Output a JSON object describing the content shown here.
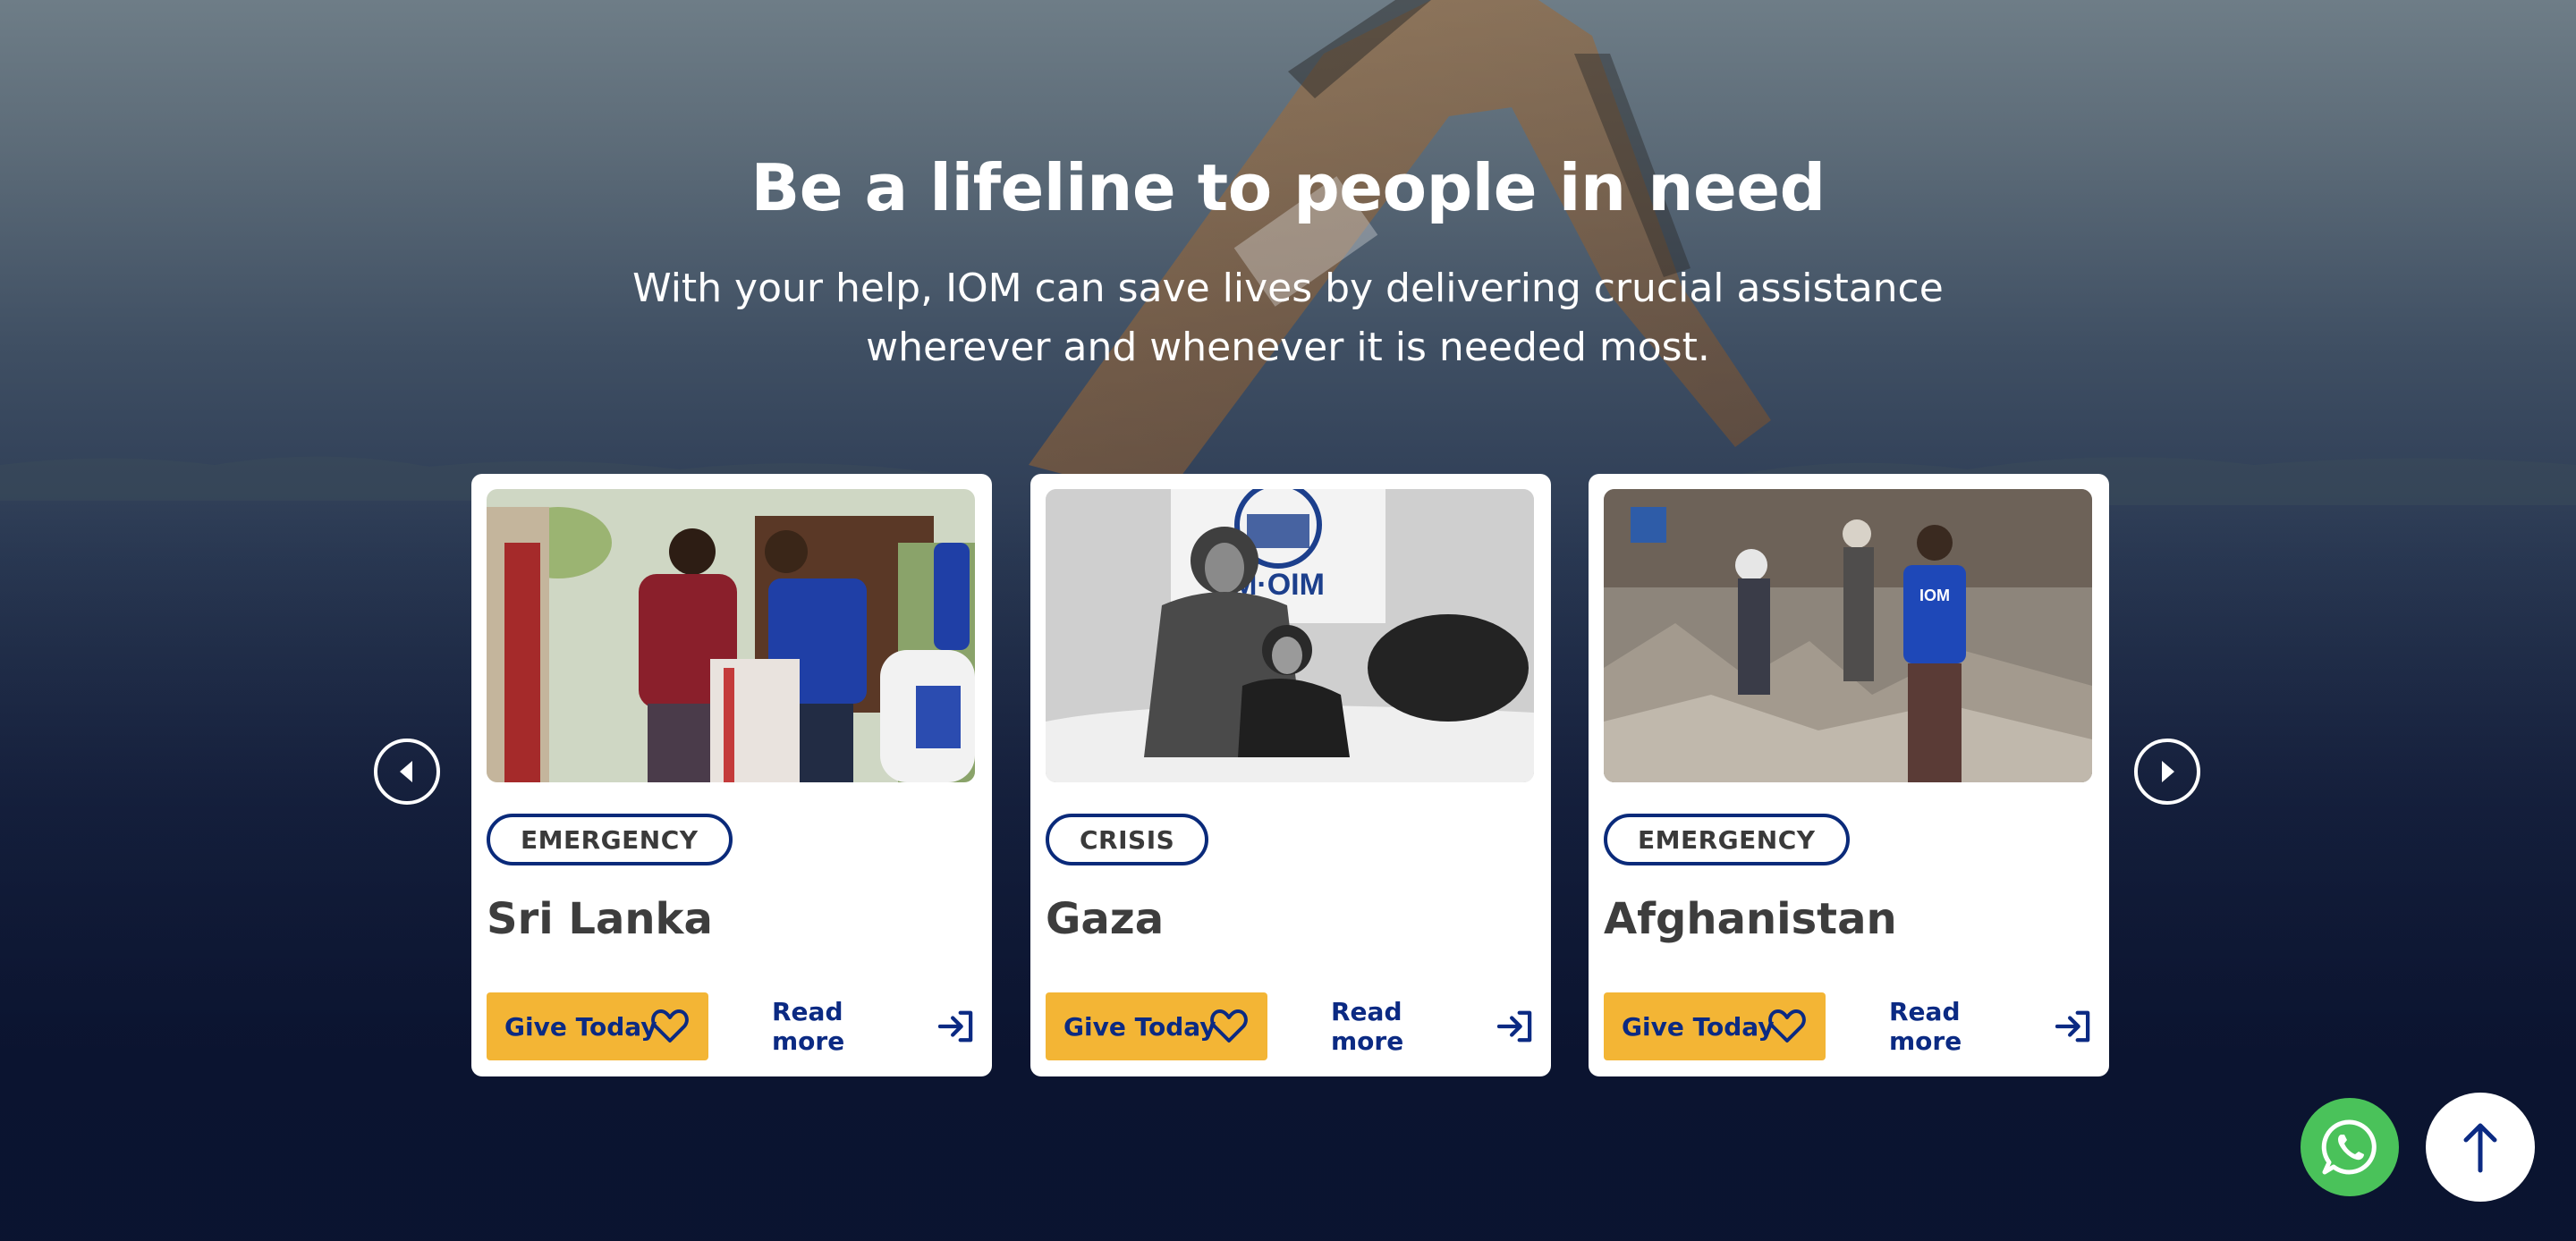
{
  "hero": {
    "title": "Be a lifeline to people in need",
    "subtitle_line1": "With your help, IOM can save lives by delivering crucial assistance",
    "subtitle_line2": "wherever and whenever it is needed most."
  },
  "carousel": {
    "prev_icon": "caret-left-icon",
    "next_icon": "caret-right-icon",
    "cards": [
      {
        "tag": "EMERGENCY",
        "title": "Sri Lanka",
        "give_label": "Give Today",
        "read_more_label": "Read more",
        "image": "aid-workers-distributing-supplies-photo"
      },
      {
        "tag": "CRISIS",
        "title": "Gaza",
        "give_label": "Give Today",
        "read_more_label": "Read more",
        "image": "woman-and-child-in-shelter-photo",
        "image_logo_text": "M·OIM"
      },
      {
        "tag": "EMERGENCY",
        "title": "Afghanistan",
        "give_label": "Give Today",
        "read_more_label": "Read more",
        "image": "earthquake-rubble-iom-staff-photo",
        "image_logo_text": "IOM"
      }
    ]
  },
  "floating": {
    "whatsapp_icon": "whatsapp-icon",
    "back_to_top_icon": "arrow-up-icon"
  },
  "colors": {
    "accent_yellow": "#f3b535",
    "brand_blue": "#0b2a83",
    "whatsapp_green": "#4ac25a",
    "hero_dark": "#0b1430"
  }
}
